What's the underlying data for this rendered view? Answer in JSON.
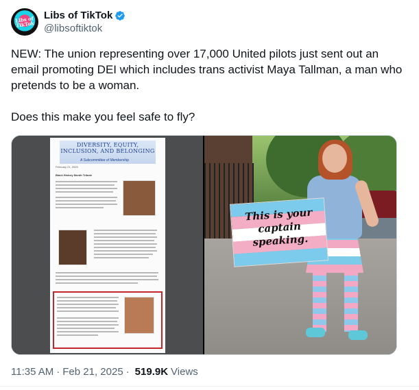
{
  "account": {
    "display_name": "Libs of TikTok",
    "handle": "@libsoftiktok",
    "avatar_text": "Libs of TikTok",
    "verified_icon": "verified-badge-icon",
    "accent_color": "#1d9bf0"
  },
  "tweet": {
    "text": "NEW: The union representing over 17,000 United pilots just sent out an email promoting DEI which includes trans activist Maya Tallman, a man who pretends to be a woman.\n\nDoes this make you feel safe to fly?"
  },
  "media": {
    "document": {
      "banner_title": "DIVERSITY, EQUITY, INCLUSION, AND BELONGING",
      "banner_subtitle": "A Subcommittee of Membership",
      "date": "February 21, 2025",
      "section_heading": "Black History Month Tribute"
    },
    "photo": {
      "sign_text": "This is your captain speaking."
    }
  },
  "footer": {
    "time": "11:35 AM",
    "separator": "·",
    "date": "Feb 21, 2025",
    "views_count": "519.9K",
    "views_label": "Views"
  }
}
